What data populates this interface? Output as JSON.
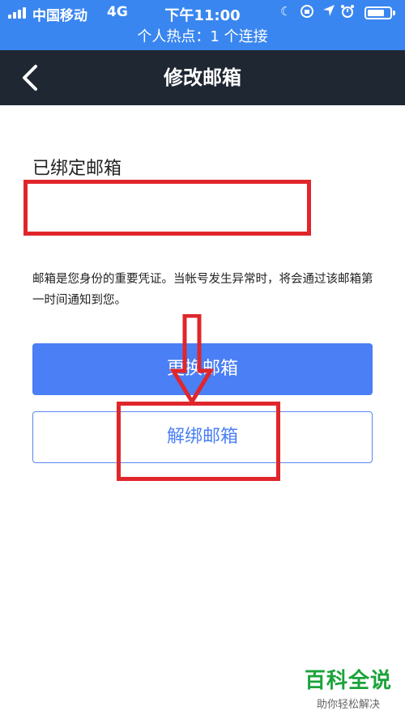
{
  "status_bar": {
    "carrier": "中国移动",
    "network": "4G",
    "time": "下午11:00",
    "hotspot": "个人热点：1 个连接",
    "icons": [
      "moon-icon",
      "rotation-lock-icon",
      "location-icon",
      "alarm-icon",
      "battery-icon"
    ]
  },
  "nav": {
    "title": "修改邮箱"
  },
  "main": {
    "bound_label": "已绑定邮箱",
    "email_value": "",
    "note": "邮箱是您身份的重要凭证。当帐号发生异常时，将会通过该邮箱第一时间通知到您。",
    "change_button": "更换邮箱",
    "unbind_button": "解绑邮箱"
  },
  "watermark": {
    "main": "百科全说",
    "sub": "助你轻松解决"
  },
  "colors": {
    "status_bar": "#3a86f0",
    "nav_bar": "#1f2733",
    "primary": "#4a7ff5",
    "annotation": "#e0262b",
    "watermark": "#1aa33a"
  }
}
